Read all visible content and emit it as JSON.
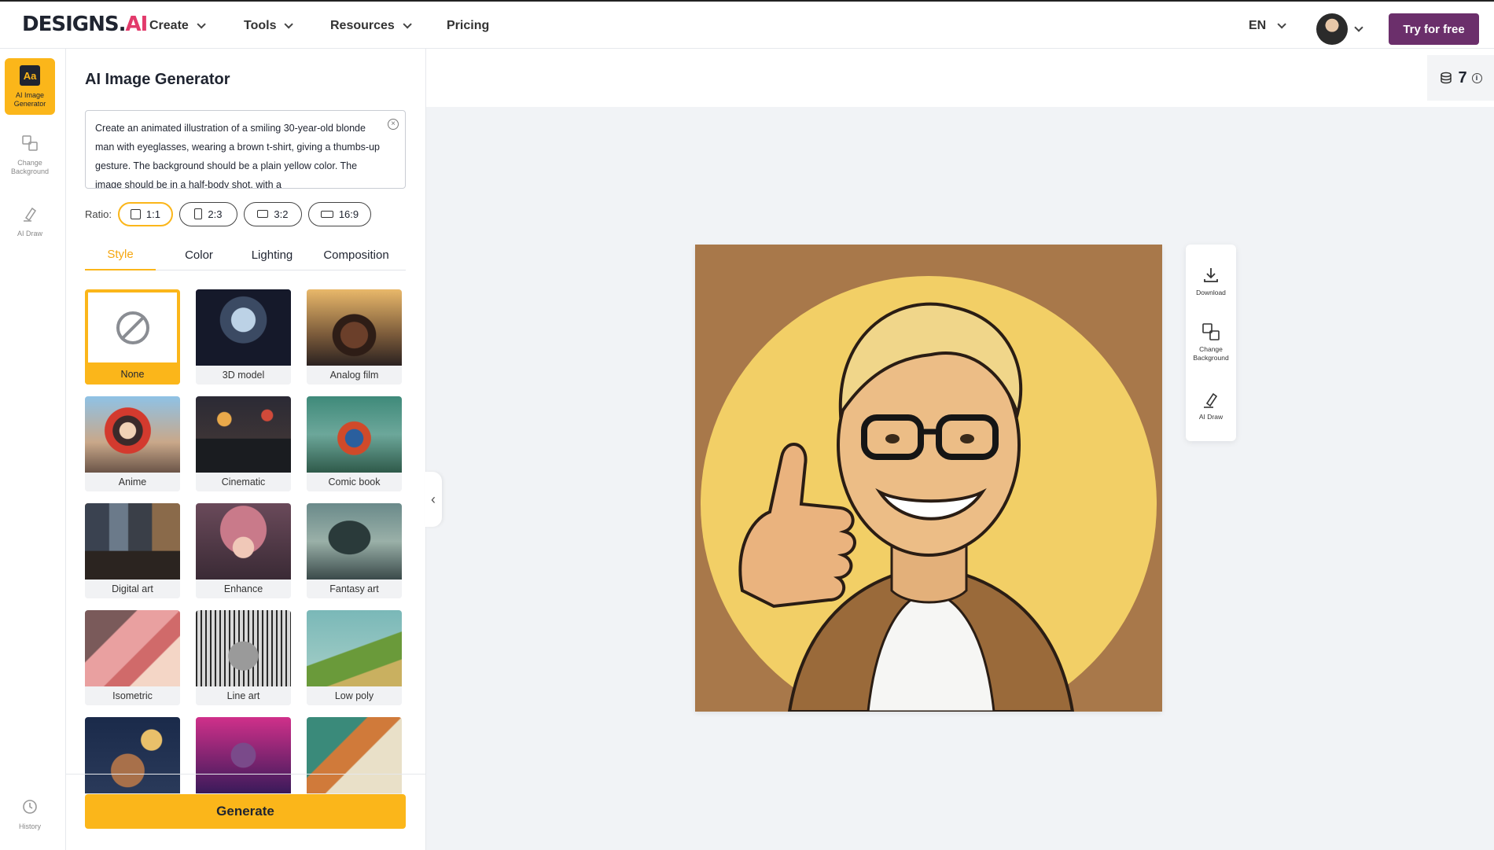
{
  "header": {
    "logo_text": "DESIGNS.",
    "logo_ai": "AI",
    "nav": [
      {
        "label": "Create"
      },
      {
        "label": "Tools"
      },
      {
        "label": "Resources"
      },
      {
        "label": "Pricing"
      }
    ],
    "language": "EN",
    "cta_label": "Try for free"
  },
  "rail": {
    "items": [
      {
        "label": "AI Image Generator",
        "icon": "aa-icon"
      },
      {
        "label": "Change Background",
        "icon": "change-background-icon"
      },
      {
        "label": "AI Draw",
        "icon": "draw-icon"
      }
    ],
    "history_label": "History"
  },
  "panel": {
    "title": "AI Image Generator",
    "prompt_text": "Create an animated illustration of a smiling 30-year-old blonde man with eyeglasses, wearing a brown t-shirt, giving a thumbs-up gesture. The background should be a plain yellow color. The image should be in a half-body shot, with a",
    "ratio_label": "Ratio:",
    "ratios": [
      {
        "label": "1:1",
        "active": true
      },
      {
        "label": "2:3",
        "active": false
      },
      {
        "label": "3:2",
        "active": false
      },
      {
        "label": "16:9",
        "active": false
      }
    ],
    "tabs": [
      {
        "label": "Style",
        "active": true
      },
      {
        "label": "Color",
        "active": false
      },
      {
        "label": "Lighting",
        "active": false
      },
      {
        "label": "Composition",
        "active": false
      }
    ],
    "styles": [
      {
        "label": "None",
        "selected": true
      },
      {
        "label": "3D model"
      },
      {
        "label": "Analog film"
      },
      {
        "label": "Anime"
      },
      {
        "label": "Cinematic"
      },
      {
        "label": "Comic book"
      },
      {
        "label": "Digital art"
      },
      {
        "label": "Enhance"
      },
      {
        "label": "Fantasy art"
      },
      {
        "label": "Isometric"
      },
      {
        "label": "Line art"
      },
      {
        "label": "Low poly"
      },
      {
        "label": ""
      },
      {
        "label": ""
      },
      {
        "label": ""
      }
    ],
    "generate_label": "Generate"
  },
  "canvas": {
    "credits": "7",
    "actions": [
      {
        "label": "Download",
        "icon": "download-icon"
      },
      {
        "label": "Change Background",
        "icon": "change-background-icon"
      },
      {
        "label": "AI Draw",
        "icon": "draw-icon"
      }
    ]
  },
  "colors": {
    "accent": "#fbb61a",
    "cta": "#6b2f6b",
    "canvas_bg": "#f1f3f6"
  }
}
